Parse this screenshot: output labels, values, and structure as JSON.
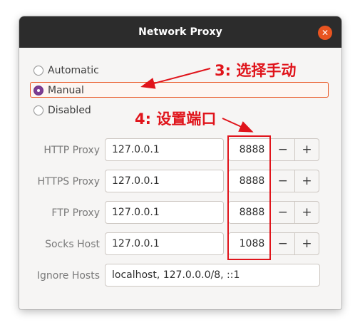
{
  "window": {
    "title": "Network Proxy",
    "close_glyph": "✕"
  },
  "radios": [
    {
      "label": "Automatic",
      "checked": false
    },
    {
      "label": "Manual",
      "checked": true
    },
    {
      "label": "Disabled",
      "checked": false
    }
  ],
  "proxies": [
    {
      "label": "HTTP Proxy",
      "host": "127.0.0.1",
      "port": "8888"
    },
    {
      "label": "HTTPS Proxy",
      "host": "127.0.0.1",
      "port": "8888"
    },
    {
      "label": "FTP Proxy",
      "host": "127.0.0.1",
      "port": "8888"
    },
    {
      "label": "Socks Host",
      "host": "127.0.0.1",
      "port": "1088"
    }
  ],
  "spin_buttons": {
    "minus": "−",
    "plus": "+"
  },
  "ignore_hosts": {
    "label": "Ignore Hosts",
    "value": "localhost, 127.0.0.0/8, ::1"
  },
  "annotations": {
    "step3": "3: 选择手动",
    "step4": "4: 设置端口"
  },
  "colors": {
    "accent": "#e95420",
    "annotation": "#e0141b",
    "radio_checked": "#7d3d94",
    "titlebar": "#2c2c2c"
  }
}
